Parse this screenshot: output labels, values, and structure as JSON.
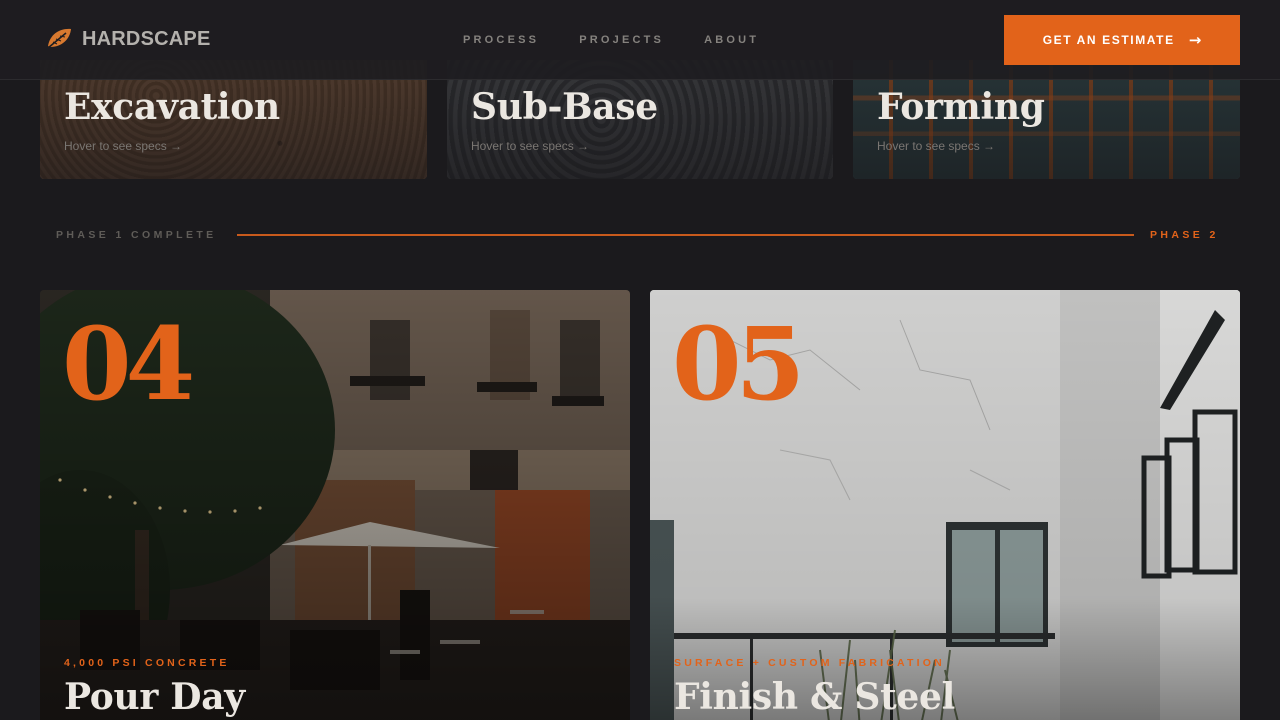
{
  "header": {
    "brand": "HARDSCAPE",
    "nav": [
      "PROCESS",
      "PROJECTS",
      "ABOUT"
    ],
    "cta_label": "GET AN ESTIMATE",
    "cta_arrow": "→"
  },
  "phase1": {
    "cards": [
      {
        "title": "Excavation",
        "hint": "Hover to see specs →"
      },
      {
        "title": "Sub-Base",
        "hint": "Hover to see specs →"
      },
      {
        "title": "Forming",
        "hint": "Hover to see specs →"
      }
    ]
  },
  "divider": {
    "left_label": "PHASE 1 COMPLETE",
    "right_label": "PHASE 2"
  },
  "phase2": {
    "cards": [
      {
        "number": "04",
        "tag": "4,000 PSI CONCRETE",
        "title": "Pour Day"
      },
      {
        "number": "05",
        "tag": "SURFACE + CUSTOM FABRICATION",
        "title": "Finish & Steel"
      }
    ]
  },
  "colors": {
    "accent": "#e2631a",
    "background": "#1b1a1d",
    "text": "#ebe7e1"
  }
}
